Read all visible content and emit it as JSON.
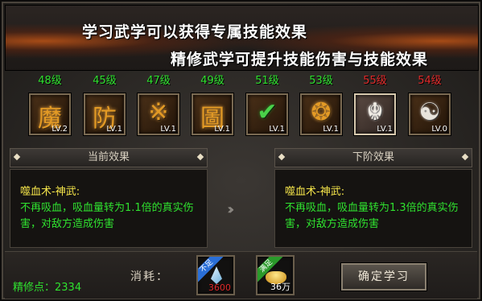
{
  "banner": {
    "line1": "学习武学可以获得专属技能效果",
    "line2": "精修武学可提升技能伤害与技能效果"
  },
  "skills": [
    {
      "level_req": "48级",
      "level_color": "#2fe12f",
      "glyph": "魔",
      "icon": "mo-rune-icon",
      "rank": "LV.2"
    },
    {
      "level_req": "45级",
      "level_color": "#2fe12f",
      "glyph": "防",
      "icon": "fang-rune-icon",
      "rank": "LV.1"
    },
    {
      "level_req": "47级",
      "level_color": "#2fe12f",
      "glyph": "※",
      "icon": "flame-rune-icon",
      "rank": "LV.1"
    },
    {
      "level_req": "49级",
      "level_color": "#2fe12f",
      "glyph": "圖",
      "icon": "tu-rune-icon",
      "rank": "LV.1"
    },
    {
      "level_req": "51级",
      "level_color": "#2fe12f",
      "glyph": "✔",
      "icon": "check-icon",
      "rank": "LV.1"
    },
    {
      "level_req": "53级",
      "level_color": "#2fe12f",
      "glyph": "❂",
      "icon": "aura-icon",
      "rank": "LV.1"
    },
    {
      "level_req": "55级",
      "level_color": "#e02a2a",
      "glyph": "☬",
      "icon": "demon-icon",
      "rank": "LV.1"
    },
    {
      "level_req": "54级",
      "level_color": "#e02a2a",
      "glyph": "☯",
      "icon": "yin-yang-icon",
      "rank": "LV.0"
    }
  ],
  "current": {
    "header": "当前效果",
    "title": "噬血术-神武:",
    "body": "不再吸血，吸血量转为1.1倍的真实伤害，对敌方造成伤害"
  },
  "next": {
    "header": "下阶效果",
    "title": "噬血术-神武:",
    "body": "不再吸血，吸血量转为1.3倍的真实伤害，对敌方造成伤害"
  },
  "arrow": "›››",
  "footer": {
    "points_label": "精修点：",
    "points_value": "2334",
    "cost_label": "消耗：",
    "costs": [
      {
        "icon": "crystal-icon",
        "status": "不足",
        "status_color": "#2a6fd8",
        "amount": "3600",
        "amount_color": "#e02a2a"
      },
      {
        "icon": "gold-ingot-icon",
        "status": "满足",
        "status_color": "#2a9a2a",
        "amount": "36万",
        "amount_color": "#ffffff"
      }
    ],
    "confirm": "确定学习"
  }
}
